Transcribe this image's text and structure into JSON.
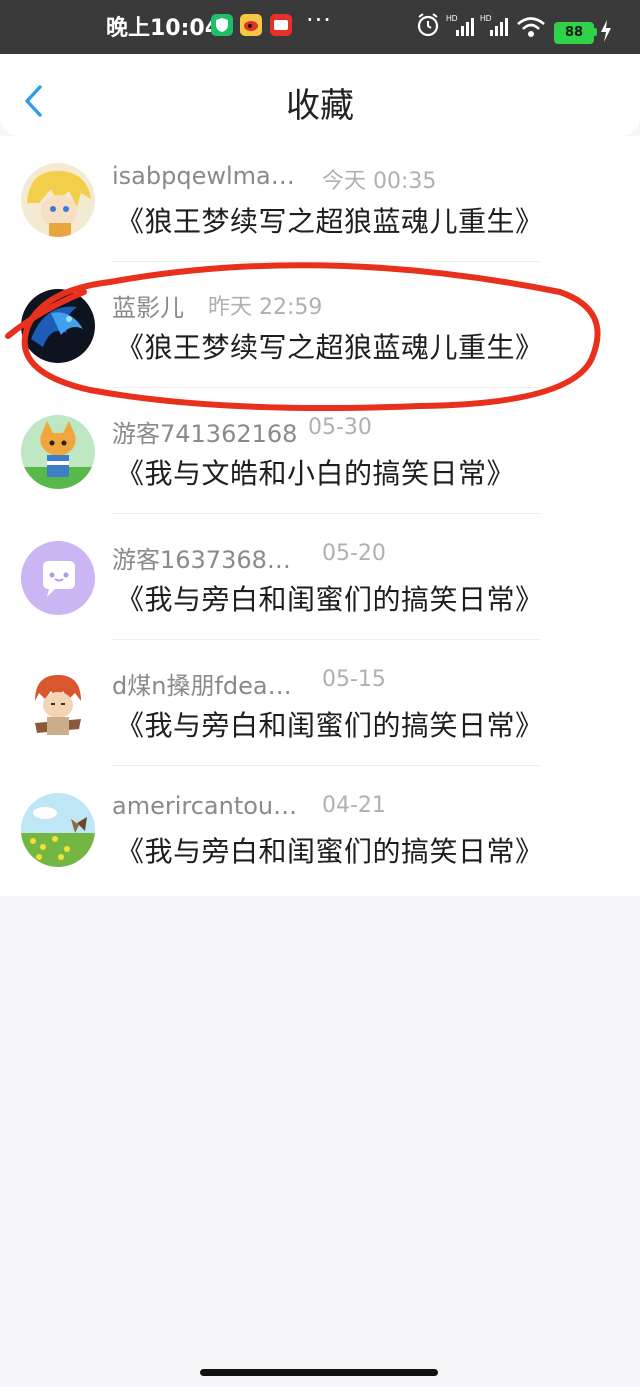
{
  "status_bar": {
    "time": "晚上10:04",
    "battery": "88"
  },
  "header": {
    "title": "收藏"
  },
  "favorites": [
    {
      "name": "isabpqewlma…",
      "date": "今天 00:35",
      "book": "《狼王梦续写之超狼蓝魂儿重生》"
    },
    {
      "name": "蓝影儿",
      "date": "昨天 22:59",
      "book": "《狼王梦续写之超狼蓝魂儿重生》"
    },
    {
      "name": "游客741362168",
      "date": "05-30",
      "book": "《我与文皓和小白的搞笑日常》"
    },
    {
      "name": "游客1637368…",
      "date": "05-20",
      "book": "《我与旁白和闺蜜们的搞笑日常》"
    },
    {
      "name": "d煤n搡朋fdea…",
      "date": "05-15",
      "book": "《我与旁白和闺蜜们的搞笑日常》"
    },
    {
      "name": "amerircantou…",
      "date": "04-21",
      "book": "《我与旁白和闺蜜们的搞笑日常》"
    }
  ],
  "colors": {
    "accent": "#2d9cf0",
    "annotation": "#e8301c",
    "status_bar": "#3a3a3a"
  }
}
